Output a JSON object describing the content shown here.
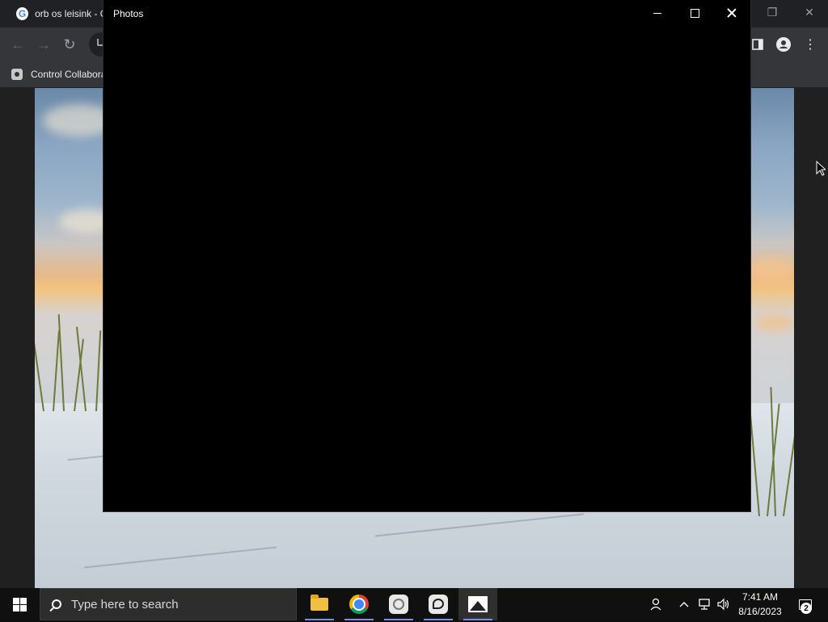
{
  "chrome": {
    "tab_title": "orb os leisink - Google",
    "bookmark_label": "Control Collabora",
    "nav": {
      "back": "←",
      "forward": "→",
      "reload": "↻"
    },
    "restore_glyph": "❐",
    "close_glyph": "✕",
    "menu_glyph": "⋮"
  },
  "photos_window": {
    "title": "Photos"
  },
  "taskbar": {
    "search_placeholder": "Type here to search",
    "apps": [
      {
        "name": "File Explorer",
        "icon": "folder-icon"
      },
      {
        "name": "Google Chrome",
        "icon": "chrome-icon"
      },
      {
        "name": "App",
        "icon": "swirl-icon"
      },
      {
        "name": "App",
        "icon": "chat-icon"
      },
      {
        "name": "Photos",
        "icon": "photos-icon"
      }
    ],
    "clock": {
      "time": "7:41 AM",
      "date": "8/16/2023"
    },
    "notification_count": "2",
    "accent_color": "#7a8de8"
  }
}
